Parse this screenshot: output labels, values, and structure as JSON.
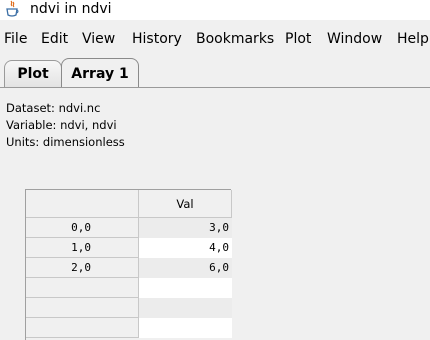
{
  "window": {
    "title": "ndvi in ndvi"
  },
  "menu": [
    "File",
    "Edit",
    "View",
    "History",
    "Bookmarks",
    "Plot",
    "Window",
    "Help"
  ],
  "tabs": [
    {
      "label": "Plot",
      "active": false
    },
    {
      "label": "Array 1",
      "active": true
    }
  ],
  "info": {
    "dataset": "Dataset: ndvi.nc",
    "variable": "Variable: ndvi, ndvi",
    "units": "Units: dimensionless"
  },
  "table": {
    "column_header": "Val",
    "rows": [
      {
        "index": "0,0",
        "value": "3,0"
      },
      {
        "index": "1,0",
        "value": "4,0"
      },
      {
        "index": "2,0",
        "value": "6,0"
      },
      {
        "index": "",
        "value": ""
      },
      {
        "index": "",
        "value": ""
      },
      {
        "index": "",
        "value": ""
      }
    ]
  },
  "colors": {
    "background": "#f0f0f0",
    "cell_white": "#ffffff",
    "grid": "#c8c8c8"
  }
}
